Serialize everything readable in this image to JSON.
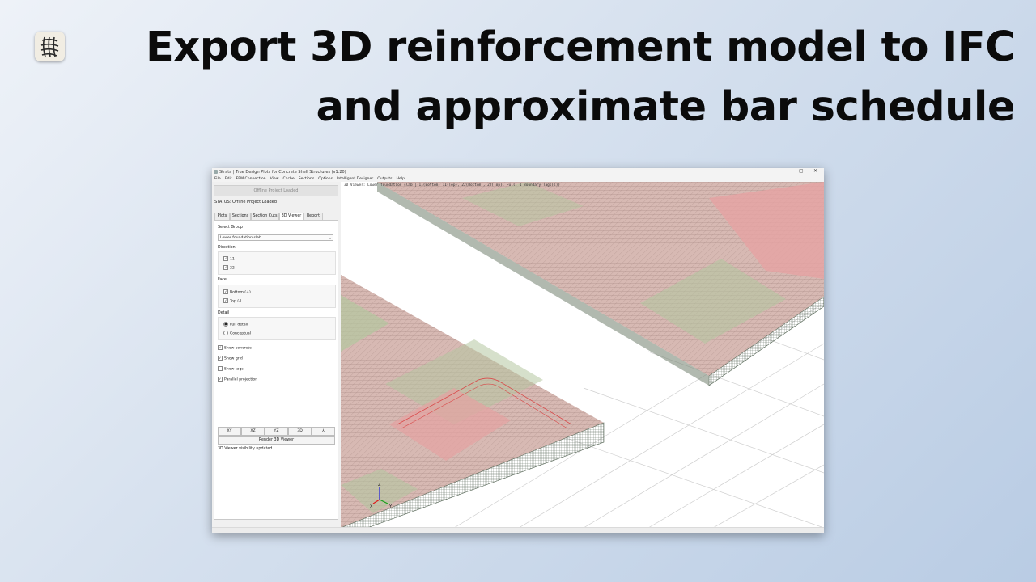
{
  "headline": {
    "line1": "Export 3D reinforcement model to IFC",
    "line2": "and approximate bar schedule"
  },
  "window": {
    "title": "Strata | True Design Plots for Concrete Shell Structures (v1.20)",
    "controls": {
      "minimize": "–",
      "maximize": "▢",
      "close": "✕"
    },
    "menu": [
      "File",
      "Edit",
      "FEM Connection",
      "View",
      "Cache",
      "Sections",
      "Options",
      "Intelligent Designer",
      "Outputs",
      "Help"
    ]
  },
  "left_panel": {
    "project_button": "Offline Project Loaded",
    "status": "STATUS: Offline Project Loaded",
    "tabs": [
      {
        "label": "Plots",
        "active": false
      },
      {
        "label": "Sections",
        "active": false
      },
      {
        "label": "Section Cuts",
        "active": false
      },
      {
        "label": "3D Viewer",
        "active": true
      },
      {
        "label": "Report",
        "active": false
      }
    ],
    "select_group_label": "Select Group",
    "select_group_value": "Lower foundation slab",
    "direction_label": "Direction",
    "direction_items": [
      {
        "label": "11",
        "checked": true
      },
      {
        "label": "22",
        "checked": true
      }
    ],
    "face_label": "Face",
    "face_items": [
      {
        "label": "Bottom (+)",
        "checked": true
      },
      {
        "label": "Top (-)",
        "checked": true
      }
    ],
    "detail_label": "Detail",
    "detail_items": [
      {
        "label": "Full detail",
        "selected": true
      },
      {
        "label": "Conceptual",
        "selected": false
      }
    ],
    "options": [
      {
        "label": "Show concrete",
        "checked": true
      },
      {
        "label": "Show grid",
        "checked": true
      },
      {
        "label": "Show tags",
        "checked": false
      },
      {
        "label": "Parallel projection",
        "checked": true
      }
    ],
    "view_buttons": [
      "XY",
      "XZ",
      "YZ",
      "3D",
      "⅄"
    ],
    "render_button": "Render 3D Viewer",
    "message": "3D Viewer visibility updated."
  },
  "viewport": {
    "info": "3D Viewer: Lower foundation slab | 11(Bottom, 11(Top), 22(Bottom), 22(Top), Full, 1 Boundary Tags(s))",
    "colors": {
      "concrete": "#c9a8a0",
      "rebar_red": "#d94a4a",
      "rebar_green": "#6a9a5a",
      "edge": "#5a6a5a"
    },
    "axis_labels": [
      "Z",
      "X",
      "Y"
    ]
  }
}
